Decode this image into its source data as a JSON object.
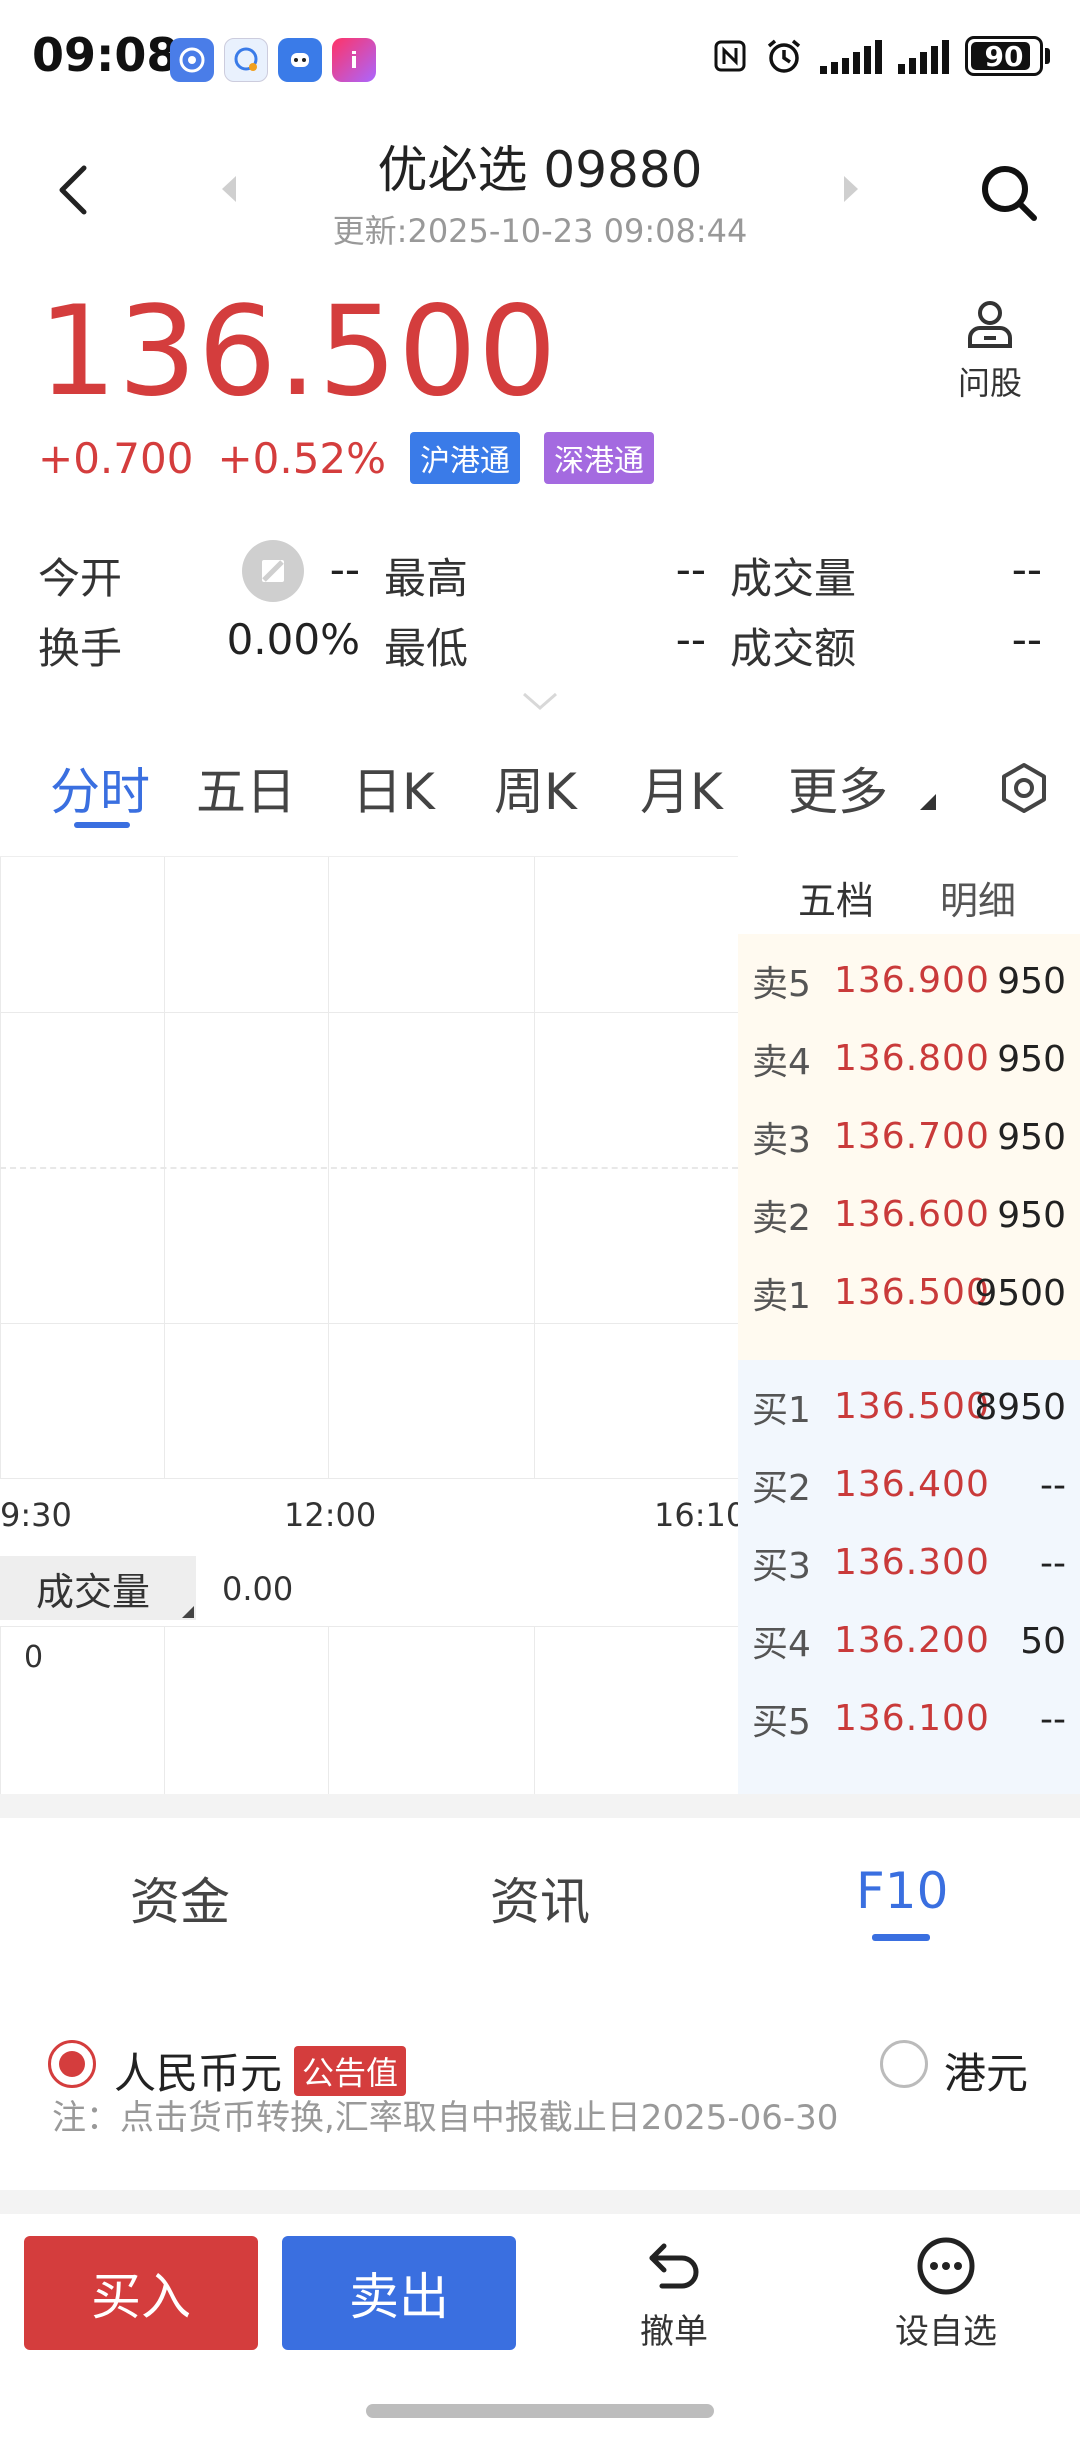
{
  "status_bar": {
    "time": "09:08",
    "battery": "90",
    "battery_level": 0.9,
    "icons": [
      "nfc-icon",
      "alarm-icon",
      "signal-icon",
      "signal-icon",
      "battery-icon"
    ]
  },
  "header": {
    "title": "优必选 09880",
    "update_time": "更新:2025-10-23 09:08:44"
  },
  "quote": {
    "price": "136.500",
    "change": "+0.700",
    "change_pct": "+0.52%",
    "tag_sh": "沪港通",
    "tag_sz": "深港通",
    "ask_label": "问股"
  },
  "stats": [
    [
      {
        "label": "今开",
        "value": "--"
      },
      {
        "label": "最高",
        "value": "--"
      },
      {
        "label": "成交量",
        "value": "--"
      }
    ],
    [
      {
        "label": "换手",
        "value": "0.00%"
      },
      {
        "label": "最低",
        "value": "--"
      },
      {
        "label": "成交额",
        "value": "--"
      }
    ]
  ],
  "chart_tabs": [
    "分时",
    "五日",
    "日K",
    "周K",
    "月K",
    "更多"
  ],
  "chart": {
    "time_labels": [
      "9:30",
      "12:00",
      "16:10"
    ],
    "volume_label": "成交量",
    "volume_value": "0.00",
    "volume_axis_zero": "0"
  },
  "orderbook": {
    "tabs": [
      "五档",
      "明细"
    ],
    "sell": [
      {
        "side": "卖5",
        "price": "136.900",
        "qty": "950"
      },
      {
        "side": "卖4",
        "price": "136.800",
        "qty": "950"
      },
      {
        "side": "卖3",
        "price": "136.700",
        "qty": "950"
      },
      {
        "side": "卖2",
        "price": "136.600",
        "qty": "950"
      },
      {
        "side": "卖1",
        "price": "136.500",
        "qty": "9500"
      }
    ],
    "buy": [
      {
        "side": "买1",
        "price": "136.500",
        "qty": "8950"
      },
      {
        "side": "买2",
        "price": "136.400",
        "qty": "--"
      },
      {
        "side": "买3",
        "price": "136.300",
        "qty": "--"
      },
      {
        "side": "买4",
        "price": "136.200",
        "qty": "50"
      },
      {
        "side": "买5",
        "price": "136.100",
        "qty": "--"
      }
    ]
  },
  "lower_tabs": [
    "资金",
    "资讯",
    "F10"
  ],
  "currency": {
    "rmb": "人民币元",
    "notice": "公告值",
    "hkd": "港元",
    "note": "注：点击货币转换,汇率取自中报截止日2025-06-30"
  },
  "bottom": {
    "buy": "买入",
    "sell": "卖出",
    "cancel": "撤单",
    "watch": "设自选"
  },
  "colors": {
    "up_red": "#d43d3d",
    "brand_blue": "#3a6fe0",
    "tag_blue": "#3a7be8",
    "tag_purple": "#a46ae0"
  }
}
